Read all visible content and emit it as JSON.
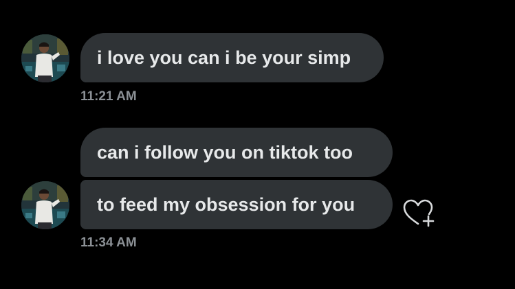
{
  "messages": [
    {
      "text": "i love you can i be your simp"
    },
    {
      "text": "can i follow you on tiktok too"
    },
    {
      "text": "to feed my obsession for you"
    }
  ],
  "timestamps": {
    "first_group": "11:21 AM",
    "second_group": "11:34 AM"
  },
  "icons": {
    "reaction": "heart-plus-icon",
    "avatar": "avatar"
  },
  "colors": {
    "background": "#000000",
    "bubble": "#2f3336",
    "text": "#e7e9ea",
    "timestamp": "#8b9095"
  }
}
